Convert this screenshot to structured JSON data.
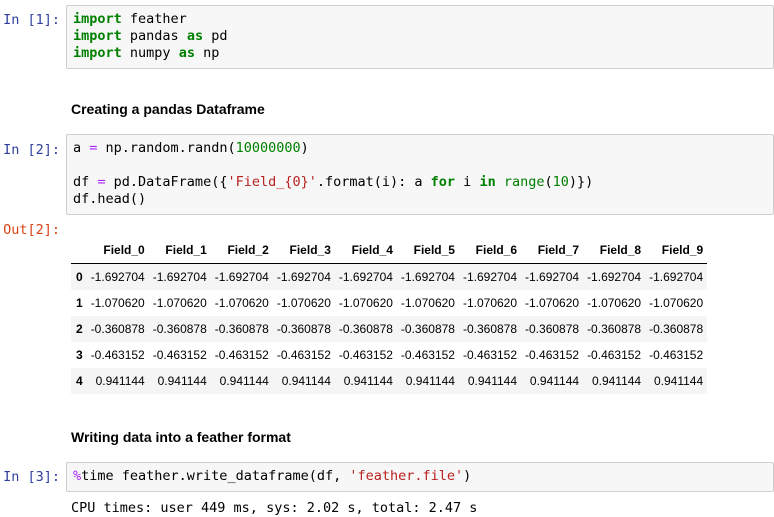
{
  "cells": {
    "c1": {
      "prompt": "In [1]:"
    },
    "md1": "Creating a pandas Dataframe",
    "c2": {
      "prompt": "In [2]:",
      "out_prompt": "Out[2]:"
    },
    "md2": "Writing data into a feather format",
    "c3": {
      "prompt": "In [3]:",
      "stdout": "CPU times: user 449 ms, sys: 2.02 s, total: 2.47 s"
    }
  },
  "dataframe": {
    "columns": [
      "Field_0",
      "Field_1",
      "Field_2",
      "Field_3",
      "Field_4",
      "Field_5",
      "Field_6",
      "Field_7",
      "Field_8",
      "Field_9"
    ],
    "rows": [
      {
        "index": "0",
        "value": "-1.692704"
      },
      {
        "index": "1",
        "value": "-1.070620"
      },
      {
        "index": "2",
        "value": "-0.360878"
      },
      {
        "index": "3",
        "value": "-0.463152"
      },
      {
        "index": "4",
        "value": "0.941144"
      }
    ]
  }
}
